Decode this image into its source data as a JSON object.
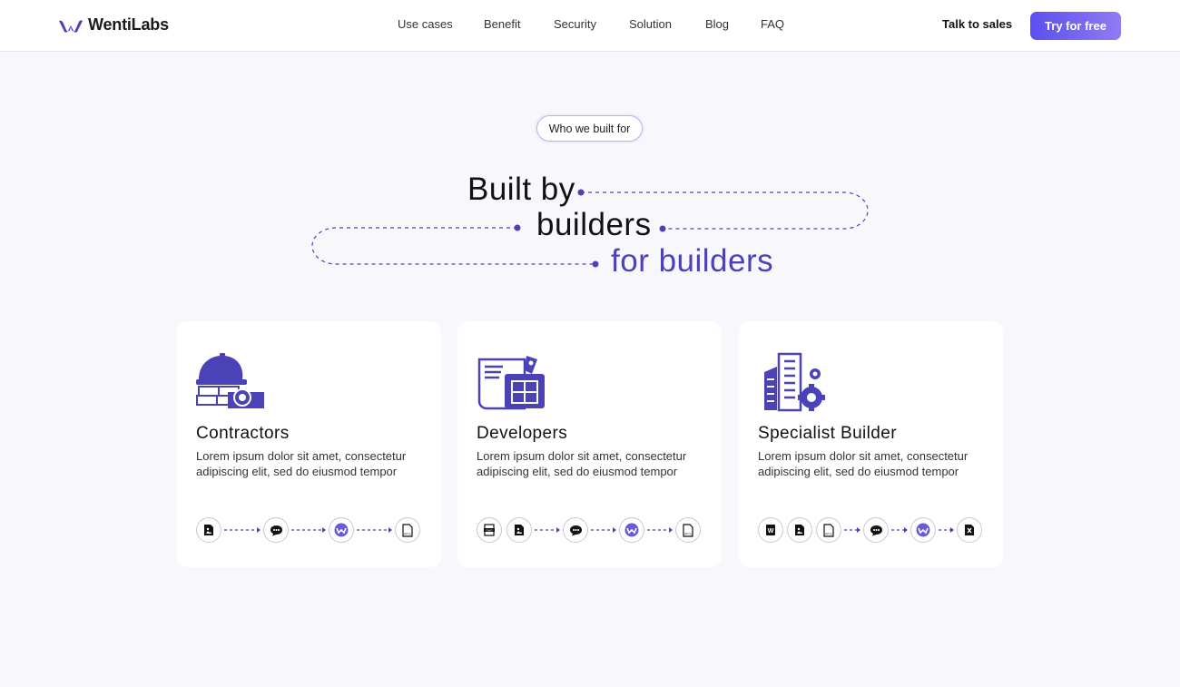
{
  "brand": {
    "name": "WentiLabs",
    "accent": "#4b42b8",
    "button_gradient": [
      "#5b4ff0",
      "#8f7cf3"
    ]
  },
  "nav": {
    "items": [
      "Use cases",
      "Benefit",
      "Security",
      "Solution",
      "Blog",
      "FAQ"
    ]
  },
  "header": {
    "talk_label": "Talk to sales",
    "cta_label": "Try for free"
  },
  "hero": {
    "badge": "Who we built for",
    "line1": "Built by",
    "line2": "builders",
    "line3": "for builders"
  },
  "cards": [
    {
      "title": "Contractors",
      "description": "Lorem ipsum dolor sit amet, consectetur adipiscing elit, sed do eiusmod tempor",
      "icon": "construction-helmet-icon",
      "flow": [
        "image-file-icon",
        "chat-icon",
        "wentilabs-logo-icon",
        "pptx-file-icon"
      ]
    },
    {
      "title": "Developers",
      "description": "Lorem ipsum dolor sit amet, consectetur adipiscing elit, sed do eiusmod tempor",
      "icon": "blueprint-icon",
      "flow": [
        "dwg-file-icon",
        "image-file-icon",
        "chat-icon",
        "wentilabs-logo-icon",
        "pptx-file-icon"
      ]
    },
    {
      "title": "Specialist Builder",
      "description": "Lorem ipsum dolor sit amet, consectetur adipiscing elit, sed do eiusmod tempor",
      "icon": "building-gear-icon",
      "flow": [
        "word-file-icon",
        "image-file-icon",
        "pptx-file-icon",
        "chat-icon",
        "wentilabs-logo-icon",
        "excel-file-icon"
      ]
    }
  ]
}
